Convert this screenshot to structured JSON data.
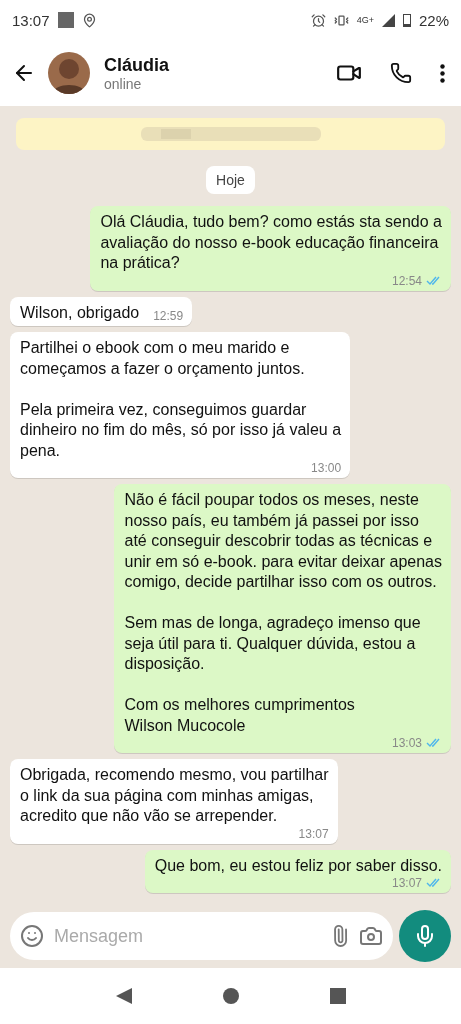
{
  "status_bar": {
    "time": "13:07",
    "network": "4G+",
    "battery": "22%"
  },
  "header": {
    "name": "Cláudia",
    "status": "online"
  },
  "date_chip": "Hoje",
  "messages": [
    {
      "kind": "sent",
      "text": "Olá Cláudia, tudo bem? como estás sta sendo a\navaliação do nosso e-book educação financeira\nna prática?",
      "time": "12:54",
      "read": true
    },
    {
      "kind": "received",
      "text": "Wilson, obrigado",
      "time": "12:59"
    },
    {
      "kind": "received",
      "text": "Partilhei o ebook com o meu marido e\ncomeçamos a fazer o orçamento juntos.\n\nPela primeira vez, conseguimos guardar\ndinheiro no fim do mês, só por isso já valeu a\npena.",
      "time": "13:00"
    },
    {
      "kind": "sent",
      "text": "Não é fácil poupar todos os meses, neste\nnosso país, eu também já passei por isso\naté conseguir descobrir todas as técnicas e\nunir em só e-book. para evitar deixar apenas\ncomigo, decide partilhar isso com os outros.\n\nSem mas de longa, agradeço imenso que\nseja útil para ti. Qualquer dúvida, estou a\ndisposição.\n\nCom os melhores cumprimentos\nWilson Mucocole",
      "time": "13:03",
      "read": true
    },
    {
      "kind": "received",
      "text": "Obrigada, recomendo mesmo, vou partilhar\no link da sua página com minhas amigas,\nacredito que não vão se arrepender.",
      "time": "13:07"
    },
    {
      "kind": "sent",
      "text": "Que bom, eu estou feliz por saber disso.",
      "time": "13:07",
      "read": true
    }
  ],
  "composer": {
    "placeholder": "Mensagem"
  }
}
